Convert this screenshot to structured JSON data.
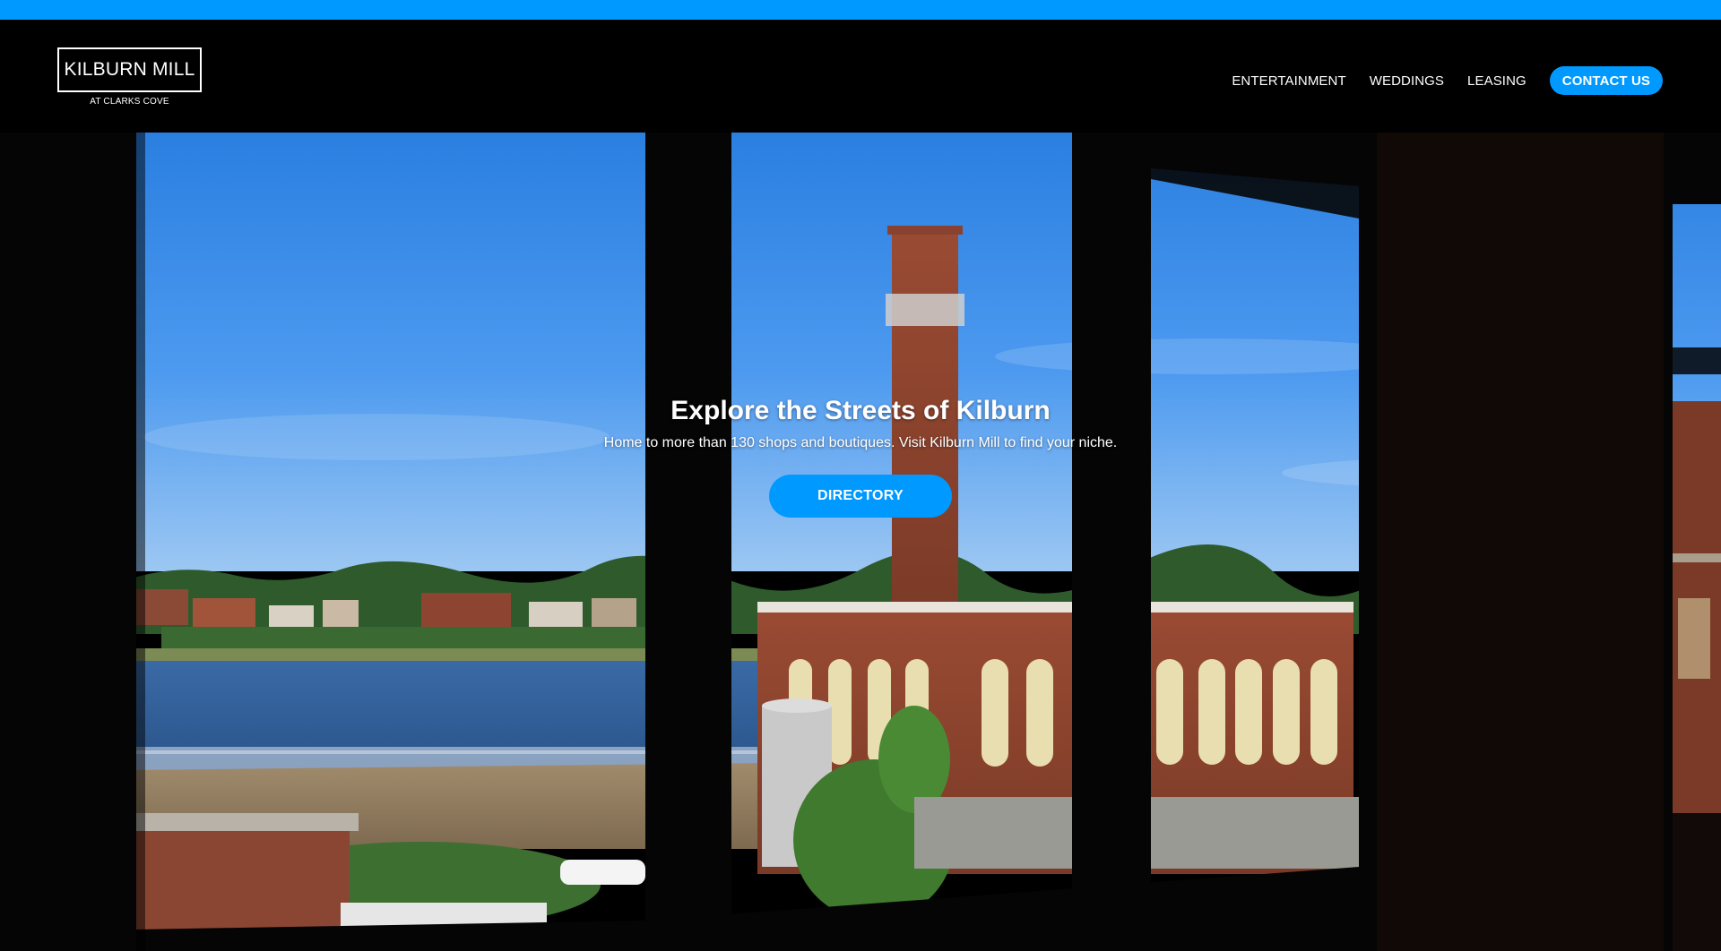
{
  "brand": {
    "name": "KILBURN MILL",
    "tagline": "AT CLARKS COVE"
  },
  "nav": {
    "items": [
      {
        "label": "ENTERTAINMENT"
      },
      {
        "label": "WEDDINGS"
      },
      {
        "label": "LEASING"
      }
    ],
    "cta_label": "CONTACT US"
  },
  "hero": {
    "title": "Explore the Streets of Kilburn",
    "subtitle": "Home to more than 130 shops and boutiques. Visit Kilburn Mill to find your niche.",
    "button_label": "DIRECTORY",
    "image_icon": "window-view-photo"
  },
  "colors": {
    "accent": "#0099ff",
    "header_bg": "#000000",
    "text": "#ffffff"
  }
}
